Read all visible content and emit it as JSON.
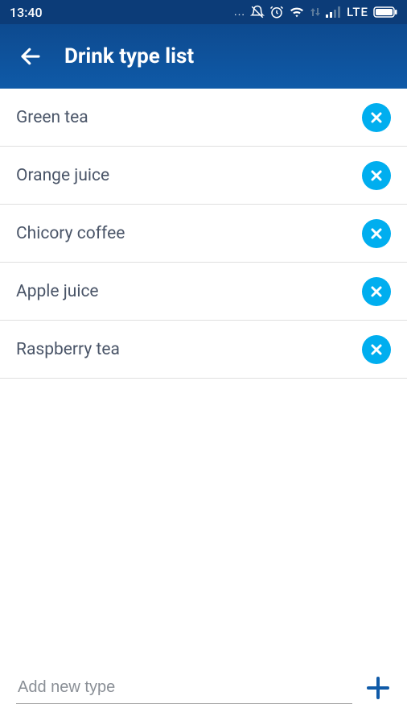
{
  "status": {
    "time": "13:40",
    "networkLabel": "LTE"
  },
  "header": {
    "title": "Drink type list"
  },
  "list": {
    "items": [
      {
        "label": "Green tea"
      },
      {
        "label": "Orange juice"
      },
      {
        "label": "Chicory coffee"
      },
      {
        "label": "Apple juice"
      },
      {
        "label": "Raspberry tea"
      }
    ]
  },
  "footer": {
    "placeholder": "Add new type"
  }
}
